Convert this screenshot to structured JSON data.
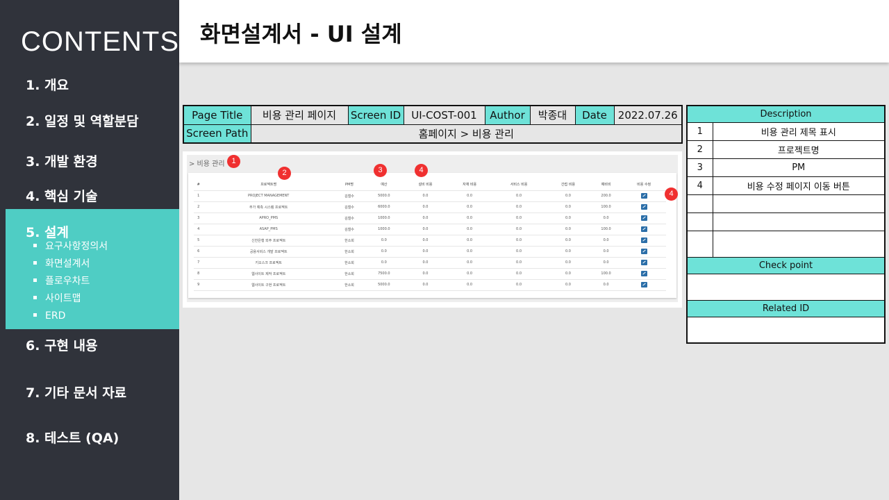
{
  "sidebar": {
    "title": "CONTENTS",
    "items": [
      {
        "label": "1.  개요"
      },
      {
        "label": "2. 일정 및 역할분담"
      },
      {
        "label": "3.  개발 환경"
      },
      {
        "label": "4.  핵심 기술"
      },
      {
        "label": "5.  설계"
      },
      {
        "label": "6.  구현 내용"
      },
      {
        "label": "7.  기타 문서 자료"
      },
      {
        "label": "8.  테스트 (QA)"
      }
    ],
    "sub_items": [
      "요구사항정의서",
      "화면설계서",
      "플로우차트",
      "사이트맵",
      "ERD"
    ],
    "active_color": "#4fcdc4"
  },
  "header": {
    "title": "화면설계서 - UI 설계"
  },
  "info": {
    "page_title_label": "Page Title",
    "page_title_value": "비용 관리 페이지",
    "screen_id_label": "Screen ID",
    "screen_id_value": "UI-COST-001",
    "author_label": "Author",
    "author_value": "박종대",
    "date_label": "Date",
    "date_value": "2022.07.26",
    "screen_path_label": "Screen Path",
    "screen_path_value": "홈페이지 > 비용 관리",
    "label_color": "#6ee2d8"
  },
  "screen": {
    "breadcrumb": "> 비용 관리",
    "columns": [
      "#",
      "프로젝트명",
      "PM명",
      "예산",
      "설비 비용",
      "자재 비용",
      "서비스 비용",
      "간접 비용",
      "예비비",
      "비용 수정"
    ],
    "rows": [
      [
        "1",
        "PROJECT MANAGEMENT",
        "김철수",
        "5000.0",
        "0.0",
        "0.0",
        "0.0",
        "0.0",
        "200.0"
      ],
      [
        "2",
        "주가 예측 시스템 프로젝트",
        "김철수",
        "6000.0",
        "0.0",
        "0.0",
        "0.0",
        "0.0",
        "100.0"
      ],
      [
        "3",
        "APRO_PMS",
        "김철수",
        "1000.0",
        "0.0",
        "0.0",
        "0.0",
        "0.0",
        "0.0"
      ],
      [
        "4",
        "ASAP_PMS",
        "김철수",
        "1000.0",
        "0.0",
        "0.0",
        "0.0",
        "0.0",
        "100.0"
      ],
      [
        "5",
        "신한은행 외주 프로젝트",
        "한소희",
        "0.0",
        "0.0",
        "0.0",
        "0.0",
        "0.0",
        "0.0"
      ],
      [
        "6",
        "공용서비스 개발 프로젝트",
        "한소희",
        "0.0",
        "0.0",
        "0.0",
        "0.0",
        "0.0",
        "0.0"
      ],
      [
        "7",
        "키오스크 프로젝트",
        "한소희",
        "0.0",
        "0.0",
        "0.0",
        "0.0",
        "0.0",
        "0.0"
      ],
      [
        "8",
        "웹사이트 제작 프로젝트",
        "한소희",
        "7500.0",
        "0.0",
        "0.0",
        "0.0",
        "0.0",
        "100.0"
      ],
      [
        "9",
        "웹사이트 구현 프로젝트",
        "한소희",
        "5000.0",
        "0.0",
        "0.0",
        "0.0",
        "0.0",
        "0.0"
      ]
    ],
    "edit_icon": "edit-icon",
    "markers": [
      "1",
      "2",
      "3",
      "4",
      "4"
    ],
    "marker_color": "#f03030"
  },
  "description": {
    "header": "Description",
    "rows": [
      {
        "num": "1",
        "text": "비용 관리 제목 표시"
      },
      {
        "num": "2",
        "text": "프로젝트명"
      },
      {
        "num": "3",
        "text": "PM"
      },
      {
        "num": "4",
        "text": "비용 수정 페이지 이동 버튼"
      },
      {
        "num": "",
        "text": ""
      },
      {
        "num": "",
        "text": ""
      },
      {
        "num": "",
        "text": ""
      }
    ],
    "checkpoint_header": "Check point",
    "checkpoint_value": "",
    "related_header": "Related ID",
    "related_value": ""
  }
}
